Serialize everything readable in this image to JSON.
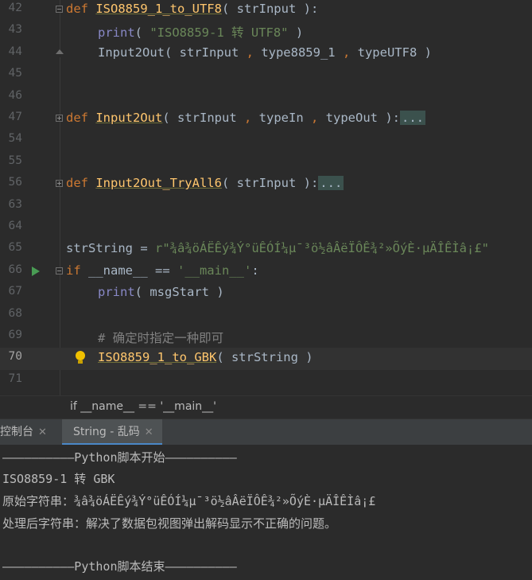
{
  "editor": {
    "lines": [
      {
        "n": "42",
        "tokens": [
          [
            "kw",
            "def "
          ],
          [
            "fn",
            "ISO8859_1_to_UTF8"
          ],
          [
            "p",
            "( strInput ):"
          ]
        ]
      },
      {
        "n": "43",
        "indent": 1,
        "tokens": [
          [
            "builtin",
            "print"
          ],
          [
            "p",
            "( "
          ],
          [
            "str",
            "\"ISO8859-1 转 UTF8\""
          ],
          [
            "p",
            " )"
          ]
        ]
      },
      {
        "n": "44",
        "indent": 1,
        "tokens": [
          [
            "p",
            "Input2Out( strInput "
          ],
          [
            "op",
            ","
          ],
          [
            "p",
            " type8859_1 "
          ],
          [
            "op",
            ","
          ],
          [
            "p",
            " typeUTF8 )"
          ]
        ]
      },
      {
        "n": "45",
        "tokens": []
      },
      {
        "n": "46",
        "tokens": []
      },
      {
        "n": "47",
        "tokens": [
          [
            "kw",
            "def "
          ],
          [
            "fn",
            "Input2Out"
          ],
          [
            "p",
            "( strInput "
          ],
          [
            "op",
            ","
          ],
          [
            "p",
            " typeIn "
          ],
          [
            "op",
            ","
          ],
          [
            "p",
            " typeOut ):"
          ],
          [
            "fold",
            "..."
          ]
        ]
      },
      {
        "n": "54",
        "tokens": []
      },
      {
        "n": "55",
        "tokens": []
      },
      {
        "n": "56",
        "tokens": [
          [
            "kw",
            "def "
          ],
          [
            "fn",
            "Input2Out_TryAll6"
          ],
          [
            "p",
            "( strInput ):"
          ],
          [
            "fold",
            "..."
          ]
        ]
      },
      {
        "n": "63",
        "tokens": []
      },
      {
        "n": "64",
        "tokens": []
      },
      {
        "n": "65",
        "tokens": [
          [
            "p",
            "strString "
          ],
          [
            "p",
            "= "
          ],
          [
            "str",
            "r\"¾â¾öÁËÊý¾Ý°üÊÓÍ¼µ¯³ö½âÂëÏÔÊ¾²»ÕýÈ·µÄÎÊÌâ¡£\""
          ]
        ]
      },
      {
        "n": "66",
        "tokens": [
          [
            "kw",
            "if "
          ],
          [
            "p",
            "__name__ == "
          ],
          [
            "str",
            "'__main__'"
          ],
          [
            "p",
            ":"
          ]
        ]
      },
      {
        "n": "67",
        "indent": 1,
        "tokens": [
          [
            "builtin",
            "print"
          ],
          [
            "p",
            "( msgStart )"
          ]
        ]
      },
      {
        "n": "68",
        "tokens": []
      },
      {
        "n": "69",
        "indent": 1,
        "tokens": [
          [
            "cmt",
            "# 确定时指定一种即可"
          ]
        ]
      },
      {
        "n": "70",
        "indent": 1,
        "tokens": [
          [
            "fn",
            "ISO8859_1_to_GBK"
          ],
          [
            "p",
            "( strString )"
          ]
        ]
      },
      {
        "n": "71",
        "tokens": []
      }
    ]
  },
  "breadcrumb": {
    "label": "if __name__ == '__main__'"
  },
  "tool_tabs": [
    {
      "label": "控制台",
      "active": false
    },
    {
      "label": "String - 乱码",
      "active": true
    }
  ],
  "console": {
    "lines": [
      "——————————Python脚本开始——————————",
      "ISO8859-1 转 GBK",
      "原始字符串：¾â¾öÁËÊý¾Ý°üÊÓÍ¼µ¯³ö½âÂëÏÔÊ¾²»ÕýÈ·µÄÎÊÌâ¡£",
      "处理后字符串：解决了数据包视图弹出解码显示不正确的问题。",
      "",
      "——————————Python脚本结束——————————"
    ]
  }
}
